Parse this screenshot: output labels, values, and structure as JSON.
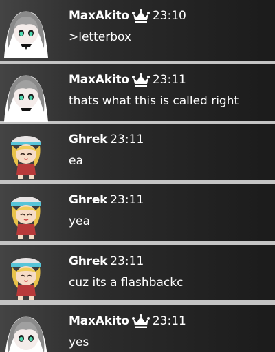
{
  "messages": [
    {
      "avatar": "gray-hooded-girl-avatar",
      "author": "MaxAkito",
      "badge": "crown-icon",
      "time": "23:10",
      "text": ">letterbox"
    },
    {
      "avatar": "gray-hooded-girl-avatar",
      "author": "MaxAkito",
      "badge": "crown-icon",
      "time": "23:11",
      "text": "thats what this is called right"
    },
    {
      "avatar": "blonde-girl-avatar",
      "author": "Ghrek",
      "badge": null,
      "time": "23:11",
      "text": "ea"
    },
    {
      "avatar": "blonde-girl-avatar",
      "author": "Ghrek",
      "badge": null,
      "time": "23:11",
      "text": "yea"
    },
    {
      "avatar": "blonde-girl-avatar",
      "author": "Ghrek",
      "badge": null,
      "time": "23:11",
      "text": "cuz its a flashbackc"
    },
    {
      "avatar": "gray-hooded-girl-avatar",
      "author": "MaxAkito",
      "badge": "crown-icon",
      "time": "23:11",
      "text": "yes"
    }
  ],
  "colors": {
    "separator": "#c4c4c4",
    "row_dark": "#1b1b1b",
    "row_light": "#444444",
    "text": "#ffffff"
  }
}
